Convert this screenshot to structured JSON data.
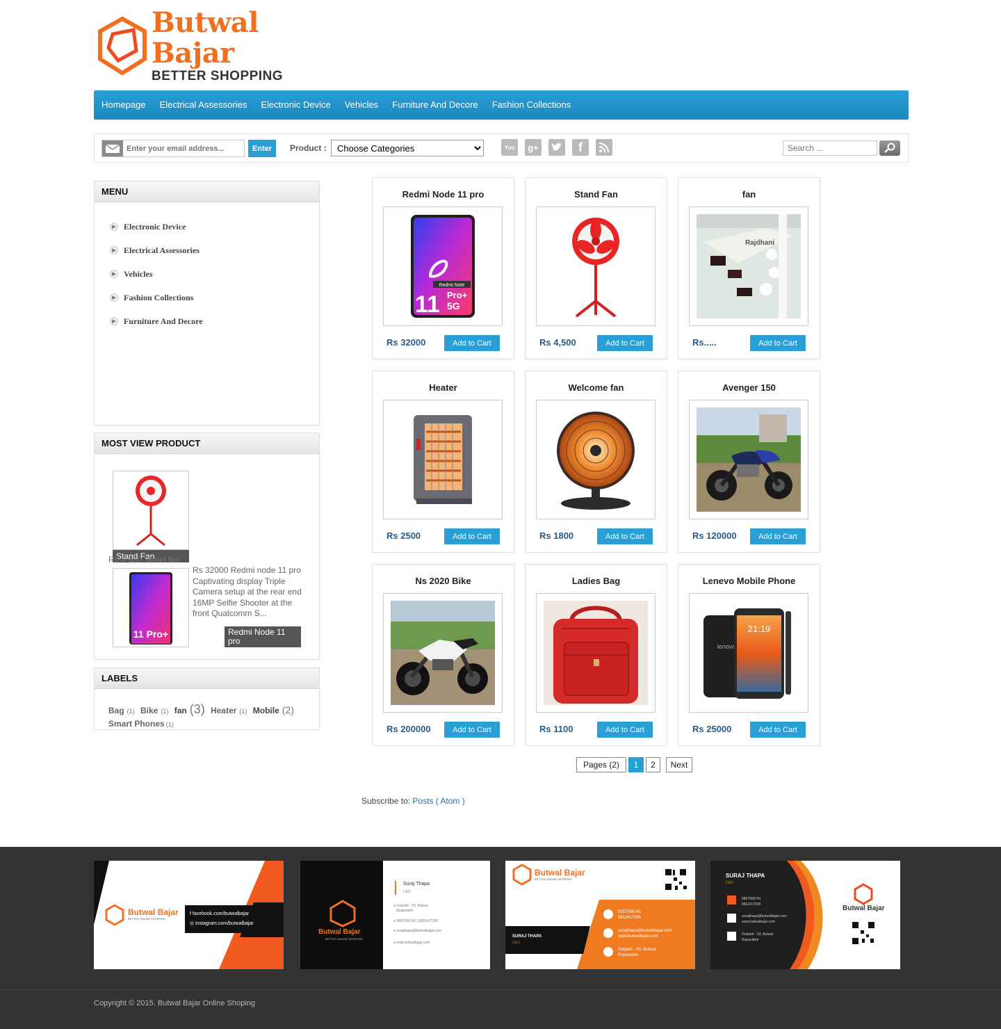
{
  "brand": {
    "title": "Butwal Bajar",
    "tagline": "BETTER SHOPPING",
    "accent_color": "#f07020",
    "nav_color": "#2a9fd6"
  },
  "nav": {
    "items": [
      "Homepage",
      "Electrical Assessories",
      "Electronic Device",
      "Vehicles",
      "Furniture And Decore",
      "Fashion Collections"
    ]
  },
  "toolbar": {
    "email_placeholder": "Enter your email address...",
    "enter_label": "Enter",
    "product_label": "Product :",
    "category_selected": "Choose Categories",
    "social_icons": [
      "youtube-icon",
      "google-plus-icon",
      "twitter-icon",
      "facebook-icon",
      "rss-icon"
    ],
    "search_placeholder": "Search ..."
  },
  "sidebar": {
    "menu_title": "MENU",
    "menu_items": [
      "Electronic Device",
      "Electrical Assessories",
      "Vehicles",
      "Fashion Collections",
      "Furniture And Decore"
    ],
    "most_view_title": "MOST VIEW PRODUCT",
    "most_view": [
      {
        "caption": "Stand Fan",
        "text": "Rs 4,500 Stand fan"
      },
      {
        "caption": "Redmi Node 11 pro",
        "text": "Rs 32000 Redmi node 11 pro Captivating display Triple Camera setup at the rear end 16MP Selfie Shooter at the front Qualcomm S..."
      }
    ],
    "labels_title": "LABELS",
    "labels": [
      {
        "name": "Bag",
        "count": "(1)"
      },
      {
        "name": "Bike",
        "count": "(1)"
      },
      {
        "name": "fan",
        "count": "(3)"
      },
      {
        "name": "Heater",
        "count": "(1)"
      },
      {
        "name": "Mobile",
        "count": "(2)"
      },
      {
        "name": "Smart Phones",
        "count": "(1)"
      }
    ]
  },
  "products": [
    {
      "title": "Redmi Node 11 pro",
      "price": "Rs 32000",
      "button": "Add to Cart",
      "image": "phone"
    },
    {
      "title": "Stand Fan",
      "price": "Rs 4,500",
      "button": "Add to Cart",
      "image": "standfan"
    },
    {
      "title": "fan",
      "price": "Rs.....",
      "button": "Add to Cart",
      "image": "ceilingfan"
    },
    {
      "title": "Heater",
      "price": "Rs 2500",
      "button": "Add to Cart",
      "image": "heater"
    },
    {
      "title": "Welcome fan",
      "price": "Rs 1800",
      "button": "Add to Cart",
      "image": "roundheater"
    },
    {
      "title": "Avenger 150",
      "price": "Rs 120000",
      "button": "Add to Cart",
      "image": "cruiser"
    },
    {
      "title": "Ns 2020 Bike",
      "price": "Rs 200000",
      "button": "Add to Cart",
      "image": "sportbike"
    },
    {
      "title": "Ladies Bag",
      "price": "Rs 1100",
      "button": "Add to Cart",
      "image": "bag"
    },
    {
      "title": "Lenevo Mobile Phone",
      "price": "Rs 25000",
      "button": "Add to Cart",
      "image": "lenovo"
    }
  ],
  "pagination": {
    "pages_label": "Pages (2)",
    "page1": "1",
    "page2": "2",
    "next": "Next"
  },
  "subscribe": {
    "prefix": "Subscribe to:",
    "link": "Posts ( Atom )"
  },
  "footer": {
    "card1": {
      "brand": "Butwal Bajar",
      "sub": "BETTER ONLINE SHOPPING",
      "facebook": "facebook.com/butwalbajar",
      "instagram": "instagram.com/butwalbajar"
    },
    "card2": {
      "brand": "Butwal Bajar",
      "sub": "BETTER ONLINE SHOPPING",
      "name": "Suraj Thapa",
      "role": "CEO",
      "address1": "Golpark - 03, Butwal",
      "address2": "Rupandehi",
      "phone": "9857056741 | 9811417095",
      "email": "surajthapa@butwalbajar.com",
      "web": "www.butwalbajar.com"
    },
    "card3": {
      "brand": "Butwal Bajar",
      "sub": "BETTER ONLINE SHOPPING",
      "name": "SURAJ THAPA",
      "role": "CEO",
      "phone1": "9857056741",
      "phone2": "9811417095",
      "email": "surajthapa@butwalbajar.com",
      "web": "www.butwalbajar.com",
      "address1": "Golpark - 03, Butwal",
      "address2": "Rupandehi"
    },
    "card4": {
      "brand": "Butwal Bajar",
      "name": "SURAJ THAPA",
      "role": "CEO",
      "phone1": "9857056741",
      "phone2": "9811417095",
      "email": "surajthapa@butwalbajar.com",
      "web": "www.butwalbajar.com",
      "address1": "Golpark - 03, Butwal",
      "address2": "Rupandehi"
    },
    "copyright": "Copyright © 2015. Butwal Bajar Online Shoping"
  }
}
